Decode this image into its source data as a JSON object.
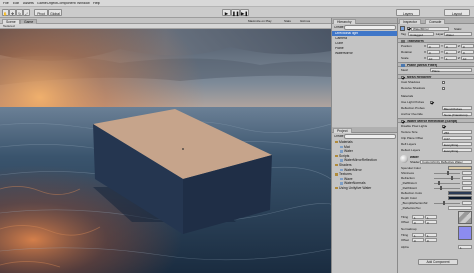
{
  "menu": [
    "File",
    "Edit",
    "Assets",
    "GameObject",
    "Component",
    "Window",
    "Help"
  ],
  "toolbar": {
    "transform_tools": [
      "✋",
      "✥",
      "↻",
      "⤢"
    ],
    "pivot_label": "Pivot",
    "space_label": "Global",
    "play": [
      "▶",
      "❚❚",
      "▶❚"
    ],
    "layers_label": "Layers",
    "layout_label": "Layout"
  },
  "scene": {
    "tabs": [
      "Scene",
      "Game"
    ],
    "shading_mode": "Textured",
    "resolution": "Maximize on Play",
    "stats_labels": [
      "Stats",
      "Gizmos"
    ]
  },
  "hierarchy": {
    "tab": "Hierarchy",
    "create_label": "Create",
    "items": [
      "Directional light",
      "Camera",
      "Cube",
      "Plane",
      "WaterMirror"
    ]
  },
  "project": {
    "tab": "Project",
    "create_label": "Create",
    "items": [
      {
        "label": "Materials",
        "indent": 0
      },
      {
        "label": "Mat",
        "indent": 1
      },
      {
        "label": "Water",
        "indent": 1
      },
      {
        "label": "Scripts",
        "indent": 0
      },
      {
        "label": "WaterMirrorReflection",
        "indent": 1
      },
      {
        "label": "Shaders",
        "indent": 0
      },
      {
        "label": "WaterMirror",
        "indent": 1
      },
      {
        "label": "Textures",
        "indent": 0
      },
      {
        "label": "Wave",
        "indent": 1
      },
      {
        "label": "WaterNormals",
        "indent": 1
      },
      {
        "label": "Using Unitylive Water",
        "indent": 0
      }
    ]
  },
  "inspector": {
    "tabs": [
      "Inspector",
      "Console"
    ],
    "object_name": "WaterMirror",
    "static_label": "Static",
    "tag_label": "Tag",
    "tag_value": "Untagged",
    "layer_label": "Layer",
    "layer_value": "Water",
    "transform": {
      "title": "Transform",
      "rows": [
        {
          "label": "Position",
          "x": "0",
          "y": "0",
          "z": "0"
        },
        {
          "label": "Rotation",
          "x": "0",
          "y": "0",
          "z": "0"
        },
        {
          "label": "Scale",
          "x": "10",
          "y": "1",
          "z": "10"
        }
      ]
    },
    "mesh_filter": {
      "title": "Plane (Mesh Filter)",
      "mesh_label": "Mesh",
      "mesh_value": "Plane"
    },
    "mesh_renderer": {
      "title": "Mesh Renderer",
      "rows": [
        {
          "label": "Cast Shadows",
          "checked": false
        },
        {
          "label": "Receive Shadows",
          "checked": false
        }
      ],
      "materials_label": "Materials",
      "light_probes_label": "Use Light Probes",
      "reflection_probes_label": "Reflection Probes",
      "reflection_probes_value": "Blend Probes",
      "anchor_label": "Anchor Override",
      "anchor_value": "None (Transform)"
    },
    "water_script": {
      "title": "Water Mirror Reflection (Script)",
      "rows": [
        {
          "label": "Disable Pixel Lights",
          "value": ""
        },
        {
          "label": "Texture Size",
          "value": "256"
        },
        {
          "label": "Clip Plane Offset",
          "value": "0.07"
        },
        {
          "label": "Refl Layers",
          "value": "Everything"
        },
        {
          "label": "Reflect Layers",
          "value": "Everything"
        }
      ]
    },
    "material": {
      "name": "water",
      "shader_label": "Shader",
      "shader_value": "Custom/Unity Reflective Water",
      "props": [
        {
          "label": "Specular Color",
          "kind": "color",
          "color": "#d9c9a8"
        },
        {
          "label": "Shininess",
          "kind": "slider",
          "fill": 0.55
        },
        {
          "label": "Refraction",
          "kind": "slider",
          "fill": 0.7
        },
        {
          "label": "_ReflDistort",
          "kind": "slider",
          "fill": 0.2
        },
        {
          "label": "_RefrDistort",
          "kind": "slider",
          "fill": 0.25
        },
        {
          "label": "Reflection Color",
          "kind": "color",
          "color": "#2a3a55"
        },
        {
          "label": "Depth Color",
          "kind": "color",
          "color": "#0c1a2e"
        },
        {
          "label": "_BumpReflectionStr",
          "kind": "slider",
          "fill": 0.4
        },
        {
          "label": "_ReflectionTex",
          "kind": "text",
          "value": ""
        }
      ],
      "tiling_label": "Tiling",
      "offset_label": "Offset",
      "tiling": [
        "1",
        "1"
      ],
      "offset": [
        "0",
        "0"
      ],
      "normalmap_label": "Normalmap",
      "normalmap_color": "#8c8cf0",
      "alpha_label": "Alpha",
      "alpha_value": "1",
      "add_component_label": "Add Component"
    }
  },
  "colors": {
    "sky_top": "#3b4a60",
    "sky_glow": "#e09a5b",
    "sea": "#2a4560",
    "cube_top": "#c5a48c",
    "cube_side": "#253650",
    "selection": "#3f76c8"
  }
}
